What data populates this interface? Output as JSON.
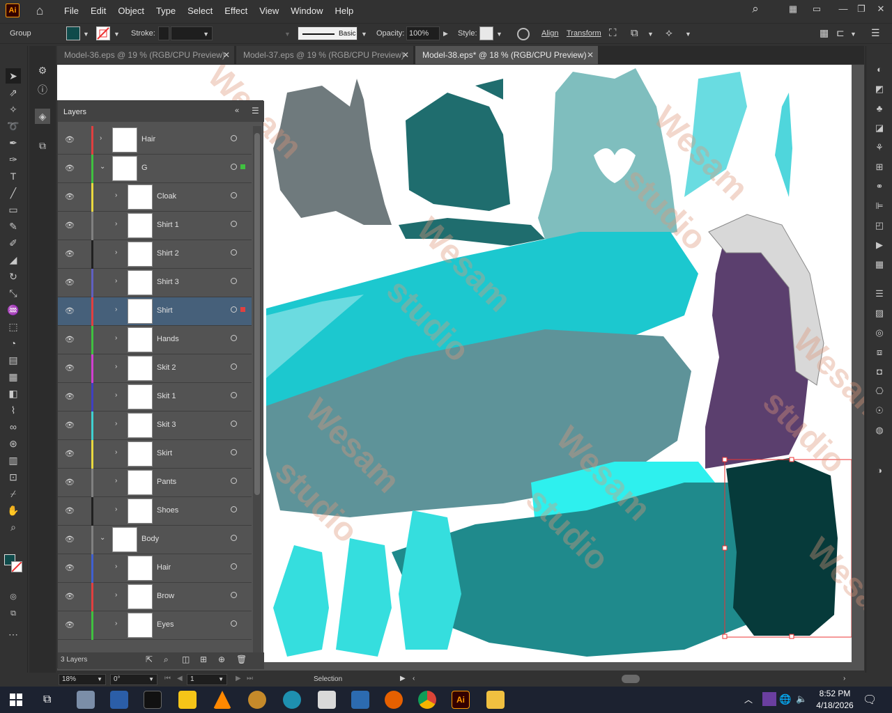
{
  "app": {
    "logo": "Ai"
  },
  "menu": [
    "File",
    "Edit",
    "Object",
    "Type",
    "Select",
    "Effect",
    "View",
    "Window",
    "Help"
  ],
  "control_bar": {
    "selection_type": "Group",
    "stroke_label": "Stroke:",
    "stroke_style": "Basic",
    "opacity_label": "Opacity:",
    "opacity_value": "100%",
    "style_label": "Style:",
    "align_label": "Align",
    "transform_label": "Transform",
    "fill_color": "#0f4b4b"
  },
  "tabs": [
    {
      "label": "Model-36.eps @ 19 % (RGB/CPU Preview)",
      "active": false
    },
    {
      "label": "Model-37.eps @ 19 % (RGB/CPU Preview)",
      "active": false
    },
    {
      "label": "Model-38.eps* @ 18 % (RGB/CPU Preview)",
      "active": true
    }
  ],
  "layers_panel": {
    "title": "Layers",
    "layer_count": "3 Layers",
    "rows": [
      {
        "name": "Hair",
        "color": "#e04040",
        "indent": 0,
        "expanded": false,
        "thumb": "hair-thumbnail"
      },
      {
        "name": "G",
        "color": "#40c040",
        "indent": 0,
        "expanded": true,
        "thumb": "group-thumbnail",
        "selected_art": true,
        "sel_color": "#40c040"
      },
      {
        "name": "Cloak",
        "color": "#e8d840",
        "indent": 1,
        "expanded": false,
        "thumb": "cloak-thumbnail"
      },
      {
        "name": "Shirt 1",
        "color": "#808080",
        "indent": 1,
        "expanded": false,
        "thumb": "shirt1-thumbnail"
      },
      {
        "name": "Shirt 2",
        "color": "#202020",
        "indent": 1,
        "expanded": false,
        "thumb": "shirt2-thumbnail"
      },
      {
        "name": "Shirt 3",
        "color": "#6060c0",
        "indent": 1,
        "expanded": false,
        "thumb": "shirt3-thumbnail"
      },
      {
        "name": "Shirt",
        "color": "#e04040",
        "indent": 1,
        "expanded": false,
        "thumb": "shirt-thumbnail",
        "selected": true,
        "selected_art": true,
        "sel_color": "#e04040"
      },
      {
        "name": "Hands",
        "color": "#40c040",
        "indent": 1,
        "expanded": false,
        "thumb": "hands-thumbnail"
      },
      {
        "name": "Skit 2",
        "color": "#d040d0",
        "indent": 1,
        "expanded": false,
        "thumb": "skit2-thumbnail"
      },
      {
        "name": "Skit 1",
        "color": "#4040c0",
        "indent": 1,
        "expanded": false,
        "thumb": "skit1-thumbnail"
      },
      {
        "name": "Skit 3",
        "color": "#40d0d0",
        "indent": 1,
        "expanded": false,
        "thumb": "skit3-thumbnail"
      },
      {
        "name": "Skirt",
        "color": "#e8d840",
        "indent": 1,
        "expanded": false,
        "thumb": "skirt-thumbnail"
      },
      {
        "name": "Pants",
        "color": "#808080",
        "indent": 1,
        "expanded": false,
        "thumb": "pants-thumbnail"
      },
      {
        "name": "Shoes",
        "color": "#202020",
        "indent": 1,
        "expanded": false,
        "thumb": "shoes-thumbnail"
      },
      {
        "name": "Body",
        "color": "#808080",
        "indent": 0,
        "expanded": true,
        "thumb": "body-thumbnail"
      },
      {
        "name": "Hair",
        "color": "#4060d0",
        "indent": 1,
        "expanded": false,
        "thumb": "body-hair-thumbnail"
      },
      {
        "name": "Brow",
        "color": "#e04040",
        "indent": 1,
        "expanded": false,
        "thumb": "brow-thumbnail"
      },
      {
        "name": "Eyes",
        "color": "#40c040",
        "indent": 1,
        "expanded": false,
        "thumb": "eyes-thumbnail"
      }
    ]
  },
  "status_bar": {
    "zoom": "18%",
    "rotation": "0°",
    "artboard": "1",
    "tool": "Selection"
  },
  "taskbar": {
    "time": "8:52 PM",
    "date": "4/18/2026"
  },
  "watermark": {
    "text": "Wesam",
    "text2": "studio"
  }
}
